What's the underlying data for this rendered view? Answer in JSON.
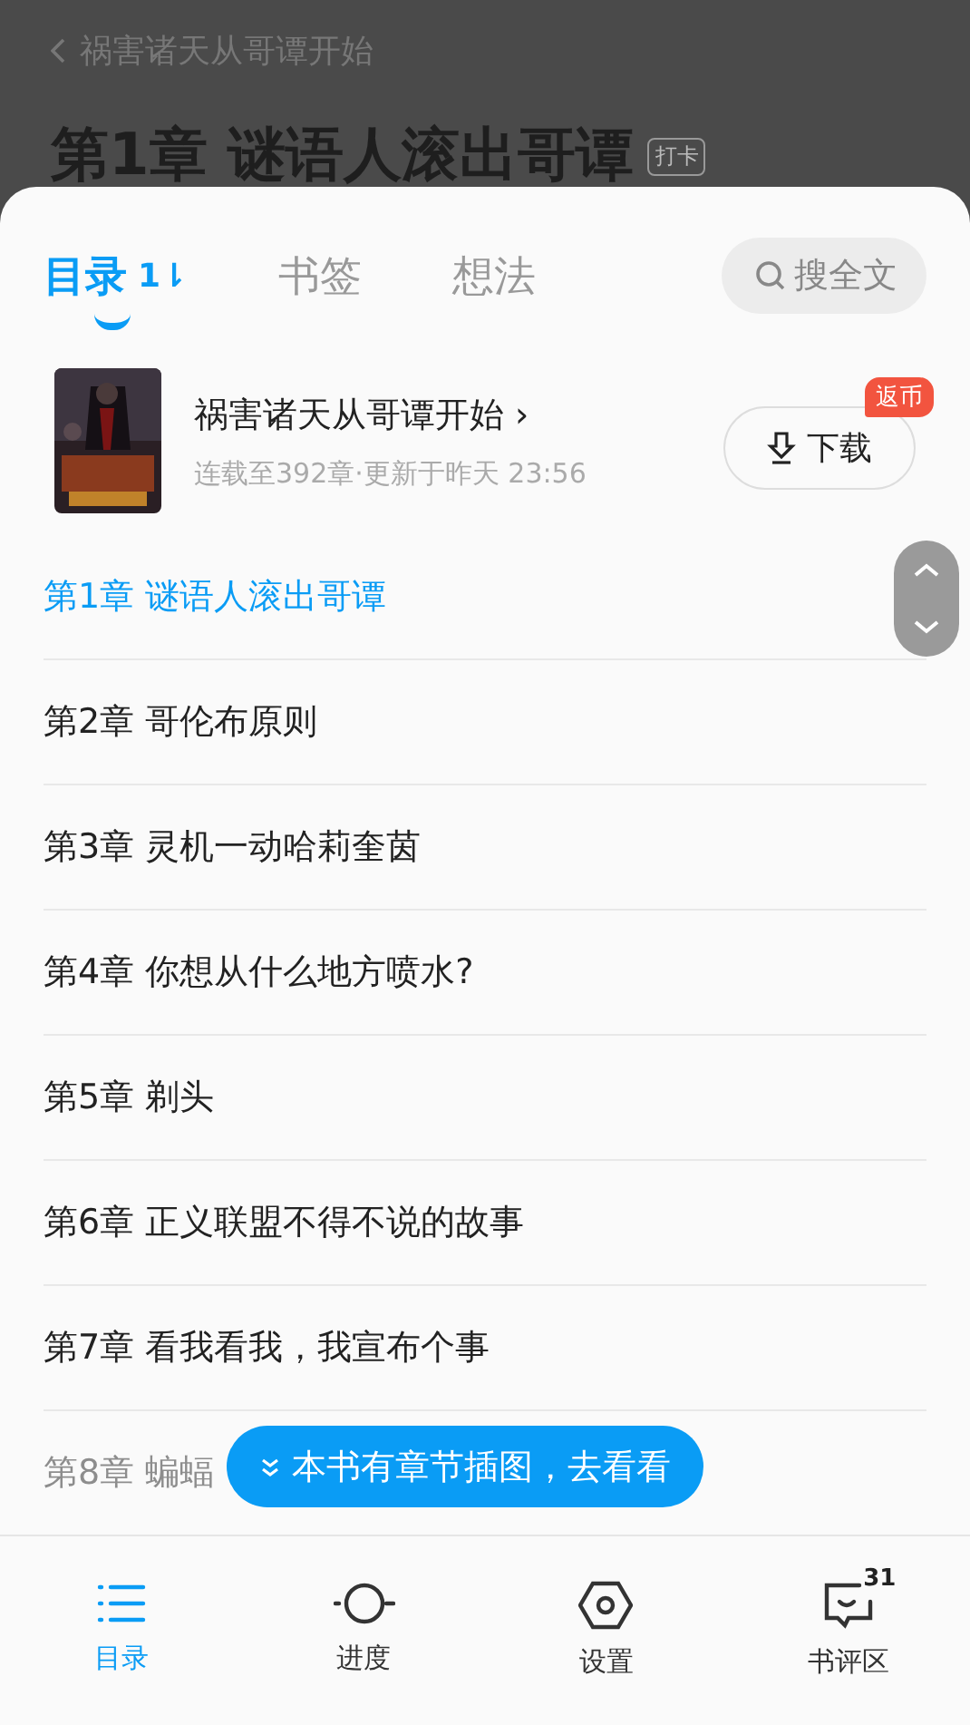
{
  "background": {
    "back_label": "祸害诸天从哥谭开始",
    "chapter_title": "第1章 谜语人滚出哥谭",
    "checkin_tag": "打卡"
  },
  "tabs": [
    {
      "label": "目录",
      "selected": true,
      "sort_icon": "1⇂"
    },
    {
      "label": "书签",
      "selected": false
    },
    {
      "label": "想法",
      "selected": false
    }
  ],
  "search": {
    "label": "搜全文"
  },
  "book": {
    "title": "祸害诸天从哥谭开始 ›",
    "meta": "连载至392章·更新于昨天 23:56",
    "download": "下载",
    "badge": "返币"
  },
  "chapters": [
    {
      "title": "第1章 谜语人滚出哥谭",
      "selected": true
    },
    {
      "title": "第2章 哥伦布原则",
      "selected": false
    },
    {
      "title": "第3章 灵机一动哈莉奎茵",
      "selected": false
    },
    {
      "title": "第4章 你想从什么地方喷水?",
      "selected": false
    },
    {
      "title": "第5章 剃头",
      "selected": false
    },
    {
      "title": "第6章 正义联盟不得不说的故事",
      "selected": false
    },
    {
      "title": "第7章 看我看我，我宣布个事",
      "selected": false
    },
    {
      "title": "第8章 蝙蝠",
      "selected": false
    }
  ],
  "floating_button": "本书有章节插图，去看看",
  "nav": [
    {
      "kind": "list",
      "label": "目录",
      "selected": true
    },
    {
      "kind": "progress",
      "label": "进度",
      "selected": false
    },
    {
      "kind": "settings",
      "label": "设置",
      "selected": false
    },
    {
      "kind": "comments",
      "label": "书评区",
      "selected": false,
      "count": "31"
    }
  ]
}
